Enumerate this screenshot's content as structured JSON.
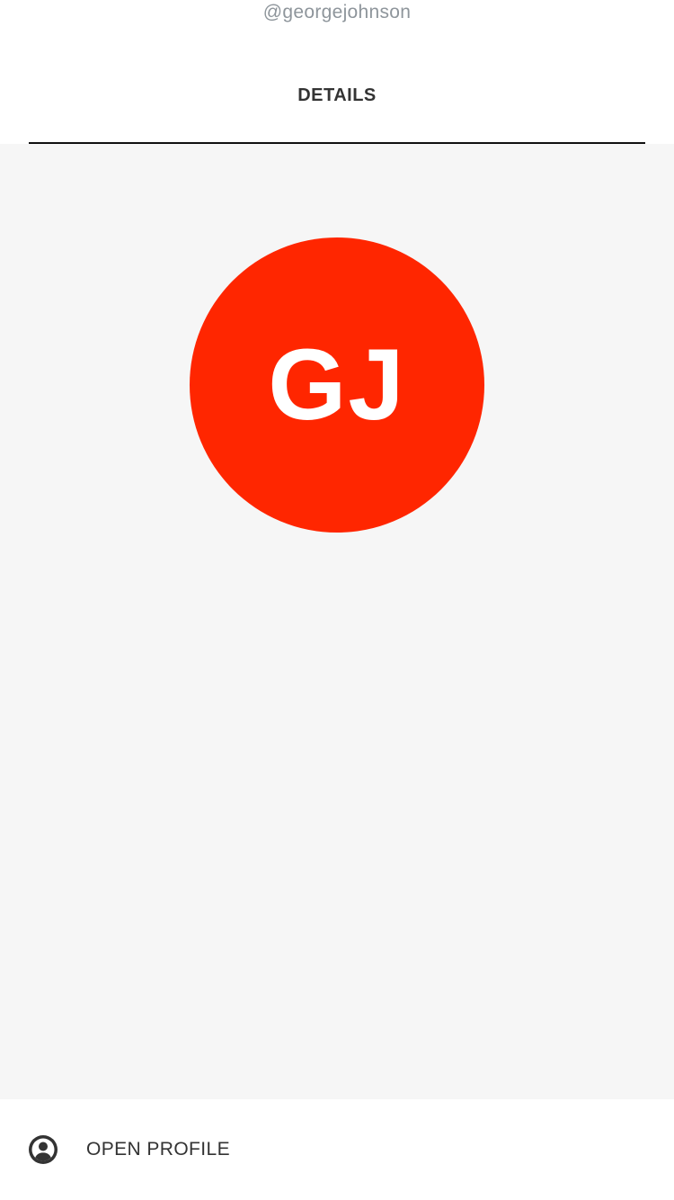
{
  "header": {
    "username": "@georgejohnson",
    "tab_label": "DETAILS"
  },
  "avatar": {
    "initials": "GJ",
    "color": "#ff2600"
  },
  "footer": {
    "open_profile_label": "OPEN PROFILE",
    "open_profile_icon": "account-circle-icon"
  },
  "colors": {
    "content_background": "#f6f6f6",
    "text_primary": "#333333",
    "text_secondary": "#8e959b"
  }
}
